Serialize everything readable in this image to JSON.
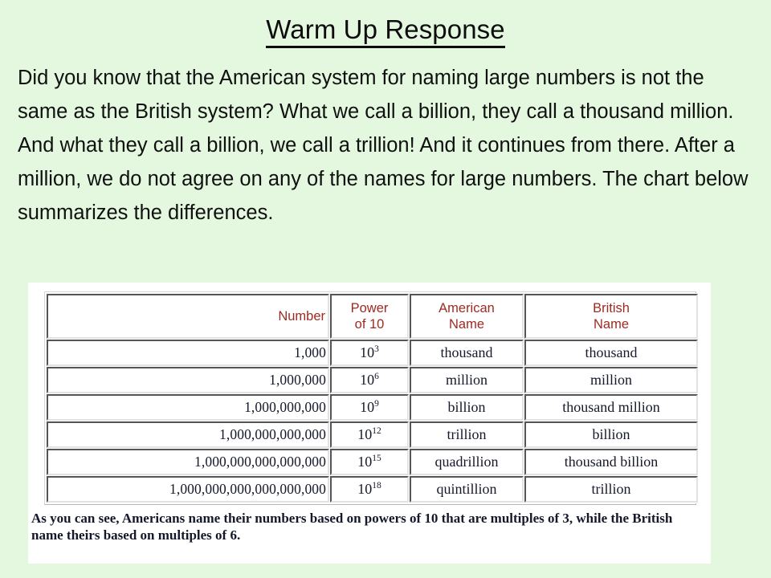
{
  "slide": {
    "title": "Warm Up Response",
    "body": "Did you know that the American system for naming large numbers is not the same as the British system? What we call a billion, they call a thousand million. And what they call a billion, we call a trillion! And it continues from there. After a million, we do not agree on any of the names for large numbers. The chart below summarizes the differences.",
    "background_color": "#e4f8e0",
    "title_color": "#0d0d0d"
  },
  "chart_data": {
    "type": "table",
    "title": "",
    "header_color": "#9e2a22",
    "columns": [
      "Number",
      "Power of 10",
      "American Name",
      "British Name"
    ],
    "columns_multiline": [
      {
        "line1": "Number",
        "line2": ""
      },
      {
        "line1": "Power",
        "line2": "of 10"
      },
      {
        "line1": "American",
        "line2": "Name"
      },
      {
        "line1": "British",
        "line2": "Name"
      }
    ],
    "rows": [
      {
        "number": "1,000",
        "power_base": "10",
        "power_exp": "3",
        "american": "thousand",
        "british": "thousand"
      },
      {
        "number": "1,000,000",
        "power_base": "10",
        "power_exp": "6",
        "american": "million",
        "british": "million"
      },
      {
        "number": "1,000,000,000",
        "power_base": "10",
        "power_exp": "9",
        "american": "billion",
        "british": "thousand million"
      },
      {
        "number": "1,000,000,000,000",
        "power_base": "10",
        "power_exp": "12",
        "american": "trillion",
        "british": "billion"
      },
      {
        "number": "1,000,000,000,000,000",
        "power_base": "10",
        "power_exp": "15",
        "american": "quadrillion",
        "british": "thousand billion"
      },
      {
        "number": "1,000,000,000,000,000,000",
        "power_base": "10",
        "power_exp": "18",
        "american": "quintillion",
        "british": "trillion"
      }
    ],
    "caption": "As you can see, Americans name their numbers based on powers of 10 that are multiples of 3, while the British name theirs based on multiples of 6."
  }
}
